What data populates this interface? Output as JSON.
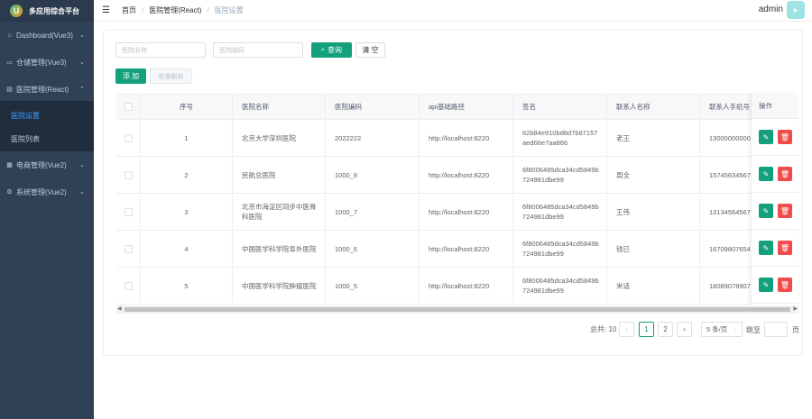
{
  "app": {
    "title": "多应用综合平台",
    "logo_glyph": "U"
  },
  "sidebar": {
    "items": [
      {
        "label": "Dashboard(Vue3)",
        "icon": "home-icon"
      },
      {
        "label": "仓储管理(Vue3)",
        "icon": "warehouse-icon"
      },
      {
        "label": "医院管理(React)",
        "icon": "hospital-icon"
      },
      {
        "label": "电商管理(Vue2)",
        "icon": "shop-icon"
      },
      {
        "label": "系统管理(Vue2)",
        "icon": "gear-icon"
      }
    ],
    "sub_items": [
      {
        "label": "医院设置",
        "active": true
      },
      {
        "label": "医院列表",
        "active": false
      }
    ]
  },
  "header": {
    "breadcrumb": [
      "首页",
      "医院管理(React)",
      "医院设置"
    ],
    "user": "admin"
  },
  "search": {
    "name_placeholder": "医院名称",
    "code_placeholder": "医院编码",
    "query_label": "查询",
    "clear_label": "清 空"
  },
  "toolbar": {
    "add_label": "添 加",
    "batch_delete_label": "批量删除"
  },
  "table": {
    "columns": [
      "序号",
      "医院名称",
      "医院编码",
      "api基础路径",
      "签名",
      "联系人名称",
      "联系人手机号",
      "操作"
    ],
    "rows": [
      {
        "index": "1",
        "name": "北京大学深圳医院",
        "code": "2022222",
        "api": "http://localhost:8220",
        "sign": "62b84e910bd6d7b67157aed66e7aa866",
        "contact": "老王",
        "phone": "13000000000"
      },
      {
        "index": "2",
        "name": "民航总医院",
        "code": "1000_8",
        "api": "http://localhost:8220",
        "sign": "6f8006485dca34cd5849b724981dbe99",
        "contact": "周全",
        "phone": "15745634567"
      },
      {
        "index": "3",
        "name": "北京市海淀区同步中医骨科医院",
        "code": "1000_7",
        "api": "http://localhost:8220",
        "sign": "6f8006485dca34cd5849b724981dbe99",
        "contact": "王伟",
        "phone": "13134564567"
      },
      {
        "index": "4",
        "name": "中国医学科学院阜外医院",
        "code": "1000_6",
        "api": "http://localhost:8220",
        "sign": "6f8006485dca34cd5849b724981dbe99",
        "contact": "钱已",
        "phone": "16709807654"
      },
      {
        "index": "5",
        "name": "中国医学科学院肿瘤医院",
        "code": "1000_5",
        "api": "http://localhost:8220",
        "sign": "6f8006485dca34cd5849b724981dbe99",
        "contact": "米话",
        "phone": "18089078907"
      }
    ]
  },
  "pagination": {
    "total": "总共: 10",
    "pages": [
      "1",
      "2"
    ],
    "prev": "‹",
    "next": "›",
    "page_size": "5 条/页",
    "goto_label": "跳至",
    "goto_suffix": "页"
  },
  "colors": {
    "primary": "#13a07a",
    "danger": "#f04c4c",
    "sidebar": "#304156",
    "active": "#409eff"
  }
}
